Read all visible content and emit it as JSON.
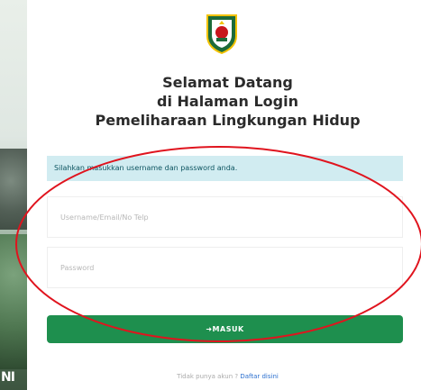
{
  "side_photo": {
    "caption": "NI"
  },
  "logo": {
    "icon": "regional-emblem-icon"
  },
  "title": {
    "line1": "Selamat Datang",
    "line2": "di Halaman Login",
    "line3": "Pemeliharaan Lingkungan Hidup"
  },
  "notice": "Silahkan masukkan username dan password anda.",
  "form": {
    "username_placeholder": "Username/Email/No Telp",
    "password_placeholder": "Password",
    "submit_label": "MASUK"
  },
  "signup": {
    "text": "Tidak punya akun ?",
    "link": "Daftar disini"
  },
  "colors": {
    "button": "#1e8f4e",
    "notice_bg": "#d1ecf1",
    "annotation": "#e0141e"
  }
}
